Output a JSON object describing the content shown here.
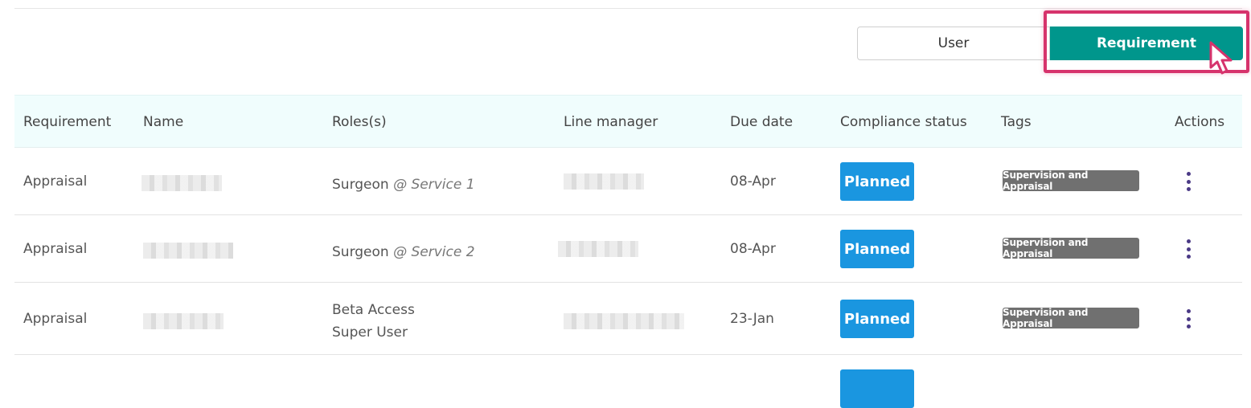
{
  "toggle": {
    "user_label": "User",
    "requirement_label": "Requirement",
    "active": "Requirement"
  },
  "table": {
    "headers": {
      "requirement": "Requirement",
      "name": "Name",
      "roles": "Roles(s)",
      "line_manager": "Line manager",
      "due_date": "Due date",
      "compliance_status": "Compliance status",
      "tags": "Tags",
      "actions": "Actions"
    },
    "rows": [
      {
        "requirement": "Appraisal",
        "role": "Surgeon",
        "service": "@ Service 1",
        "due_date": "08-Apr",
        "status": "Planned",
        "tag": "Supervision and Appraisal"
      },
      {
        "requirement": "Appraisal",
        "role": "Surgeon",
        "service": "@ Service 2",
        "due_date": "08-Apr",
        "status": "Planned",
        "tag": "Supervision and Appraisal"
      },
      {
        "requirement": "Appraisal",
        "role_line1": "Beta Access",
        "role_line2": "Super User",
        "due_date": "23-Jan",
        "status": "Planned",
        "tag": "Supervision and Appraisal"
      }
    ]
  },
  "colors": {
    "accent": "#00968c",
    "status_planned": "#1a96e0",
    "tag": "#707070",
    "highlight": "#d6336c",
    "header_bg": "#f0fdfd",
    "kebab": "#4b3a86"
  },
  "icons": {
    "actions": "kebab-menu-icon",
    "pointer": "cursor-pointer-icon"
  }
}
